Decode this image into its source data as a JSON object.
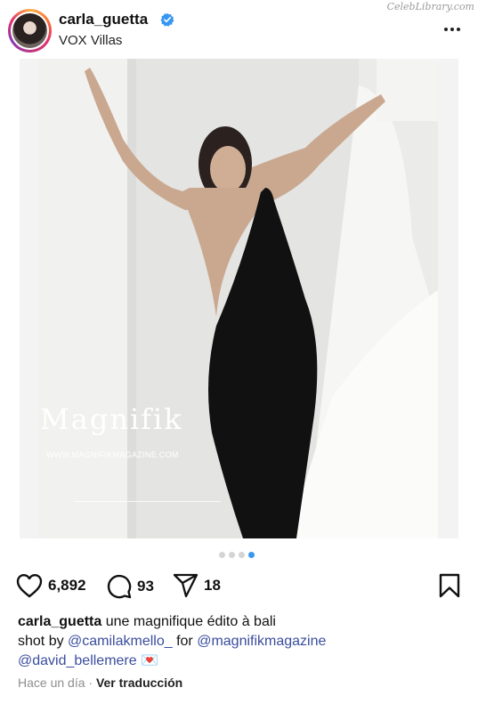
{
  "watermark": "CelebLibrary.com",
  "post": {
    "username": "carla_guetta",
    "location": "VOX Villas",
    "verified": true
  },
  "media": {
    "overlay_brand": "Magnifik",
    "overlay_site": "WWW.MAGNIFIKMAGAZINE.COM",
    "carousel_count": 4,
    "carousel_active_index": 3
  },
  "actions": {
    "likes": "6,892",
    "comments": "93",
    "shares": "18"
  },
  "caption": {
    "author": "carla_guetta",
    "text_1": " une magnifique édito à bali",
    "text_2": "shot by ",
    "mention_1": "@camilakmello_",
    "text_3": " for ",
    "mention_2": "@magnifikmagazine",
    "mention_3": "@david_bellemere",
    "emoji": "💌"
  },
  "meta": {
    "time": "Hace un día",
    "separator": "·",
    "translate": "Ver traducción"
  },
  "colors": {
    "link": "#3a4e9d",
    "verified": "#3897f0",
    "active_dot": "#3897f0"
  }
}
